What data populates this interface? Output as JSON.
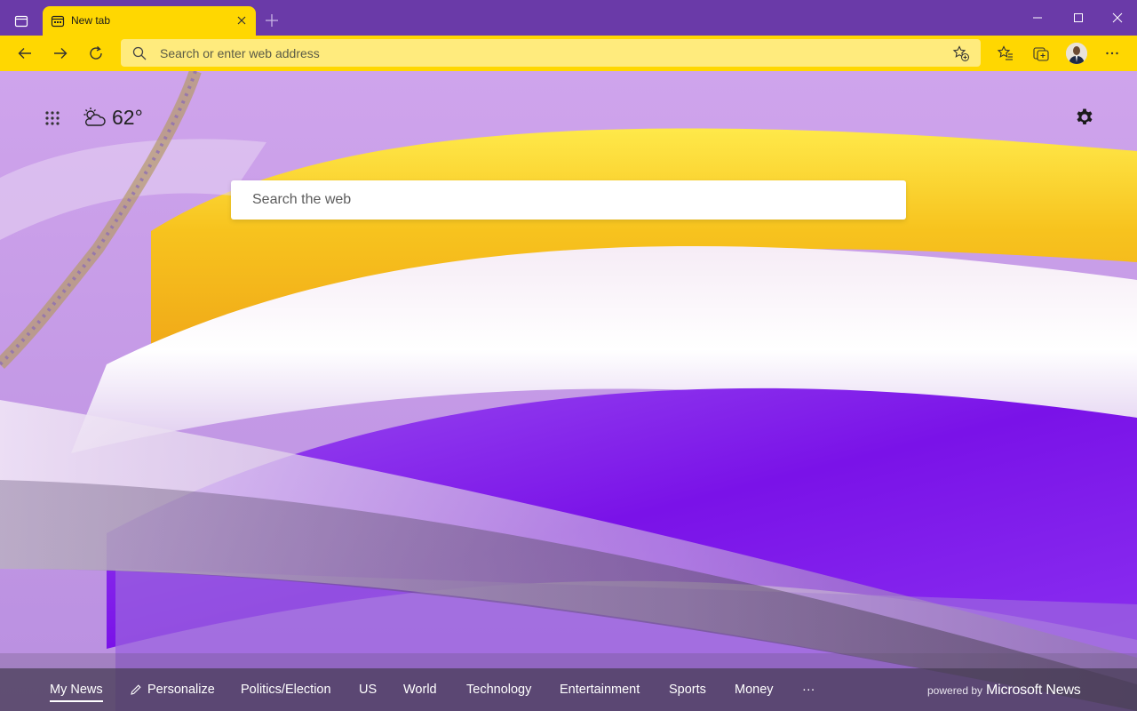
{
  "tab": {
    "title": "New tab"
  },
  "address_bar": {
    "placeholder": "Search or enter web address"
  },
  "weather": {
    "temperature": "62°",
    "condition_icon": "partly-cloudy-icon"
  },
  "search": {
    "placeholder": "Search the web"
  },
  "news_nav": {
    "items": [
      "My News",
      "Personalize",
      "Politics/Election",
      "US",
      "World",
      "Technology",
      "Entertainment",
      "Sports",
      "Money"
    ],
    "more": "···",
    "powered_by": "powered by",
    "brand": "Microsoft News"
  },
  "colors": {
    "accent_yellow": "#ffd701",
    "titlebar_purple": "#6a3aa8",
    "background_lilac": "#c9a0e8"
  }
}
